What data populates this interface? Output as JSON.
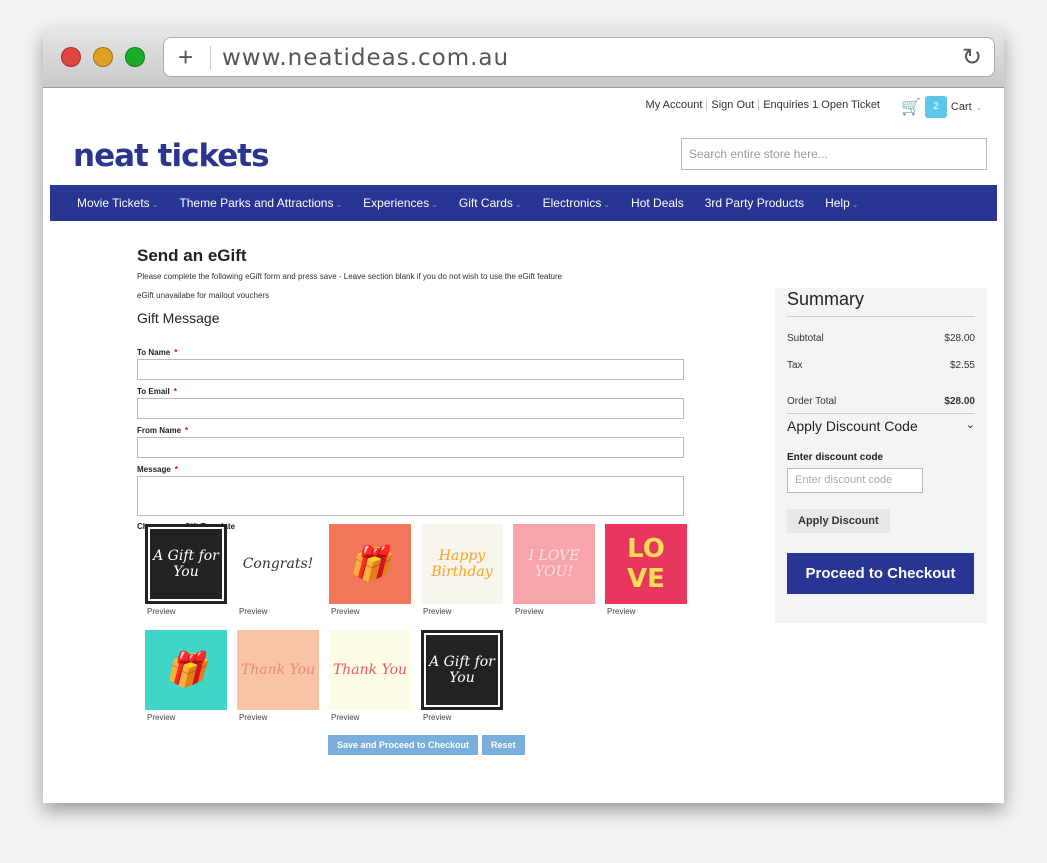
{
  "browser": {
    "url": "www.neatideas.com.au",
    "new_tab_icon": "plus-icon",
    "reload_icon": "reload-icon",
    "window_controls": [
      "#e0443e",
      "#dea123",
      "#1aab29"
    ]
  },
  "header": {
    "links": [
      "My Account",
      "Sign Out",
      "Enquiries 1 Open Ticket"
    ],
    "cart_count": "2",
    "cart_label": "Cart",
    "logo": "neat tickets",
    "search_placeholder": "Search entire store here..."
  },
  "nav": [
    "Movie Tickets",
    "Theme Parks and Attractions",
    "Experiences",
    "Gift Cards",
    "Electronics",
    "Hot Deals",
    "3rd Party Products",
    "Help"
  ],
  "nav_has_caret": [
    true,
    true,
    true,
    true,
    true,
    false,
    false,
    true
  ],
  "form": {
    "title": "Send an eGift",
    "instructions": "Please complete the following eGift form and press save - Leave section blank if you do not wish to use the eGift feature",
    "note": "eGift unavailabe for mailout vouchers",
    "section": "Gift Message",
    "fields": [
      {
        "label": "To Name",
        "required": "*"
      },
      {
        "label": "To Email",
        "required": "*"
      },
      {
        "label": "From Name",
        "required": "*"
      },
      {
        "label": "Message",
        "required": "*"
      }
    ],
    "template_label": "Choose an eGift Template",
    "preview_label": "Preview",
    "templates": [
      {
        "text": "A Gift for You",
        "bg": "#222222",
        "fg": "#ffffff"
      },
      {
        "text": "Congrats!",
        "bg": "#ffffff",
        "fg": "#333333"
      },
      {
        "text": "🎁",
        "bg": "#f2775a",
        "fg": "#ffffff"
      },
      {
        "text": "Happy Birthday",
        "bg": "#f7f5ee",
        "fg": "#f5a623"
      },
      {
        "text": "I LOVE YOU!",
        "bg": "#f7a4ab",
        "fg": "#fbe3e5"
      },
      {
        "text": "LO VE",
        "bg": "#e8365f",
        "fg": "#f7de52"
      },
      {
        "text": "🎁",
        "bg": "#3fd6c8",
        "fg": "#ffffff"
      },
      {
        "text": "Thank You",
        "bg": "#f9c3a6",
        "fg": "#e98c75"
      },
      {
        "text": "Thank You",
        "bg": "#fdfce6",
        "fg": "#ef5a5a"
      },
      {
        "text": "A Gift for You",
        "bg": "#222222",
        "fg": "#ffffff"
      }
    ],
    "save_button": "Save and Proceed to Checkout",
    "reset_button": "Reset"
  },
  "summary": {
    "title": "Summary",
    "subtotal_label": "Subtotal",
    "subtotal": "$28.00",
    "tax_label": "Tax",
    "tax": "$2.55",
    "total_label": "Order Total",
    "total": "$28.00",
    "discount_title": "Apply Discount Code",
    "discount_field_label": "Enter discount code",
    "discount_placeholder": "Enter discount code",
    "apply_button": "Apply Discount",
    "checkout_button": "Proceed to Checkout"
  },
  "colors": {
    "brand": "#283593",
    "accent": "#5bc8e8"
  }
}
